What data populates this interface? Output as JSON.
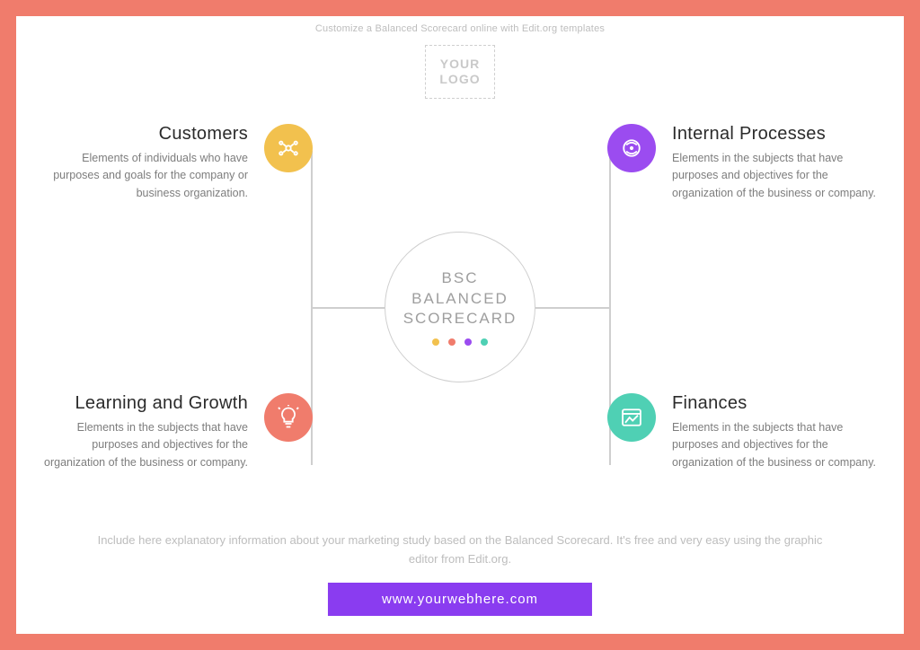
{
  "top_caption": "Customize a Balanced Scorecard online with Edit.org templates",
  "logo_text": "YOUR LOGO",
  "center": {
    "line1": "BSC",
    "line2": "BALANCED",
    "line3": "SCORECARD"
  },
  "colors": {
    "yellow": "#f2c14e",
    "coral": "#f07c6c",
    "purple": "#9b4cf0",
    "teal": "#4fd0b4"
  },
  "quadrants": {
    "customers": {
      "title": "Customers",
      "body": "Elements of individuals who have purposes and goals for the company or business organization."
    },
    "internal": {
      "title": "Internal Processes",
      "body": "Elements in the subjects that have purposes and objectives for the organization of the business or company."
    },
    "learning": {
      "title": "Learning and Growth",
      "body": "Elements in the subjects that have purposes and objectives for the organization of the business or company."
    },
    "finances": {
      "title": "Finances",
      "body": "Elements in the subjects that have purposes and objectives for the organization of the business or company."
    }
  },
  "bottom_caption": "Include here explanatory information about your marketing study based on the Balanced Scorecard. It's free and very easy using the graphic editor from Edit.org.",
  "url": "www.yourwebhere.com"
}
